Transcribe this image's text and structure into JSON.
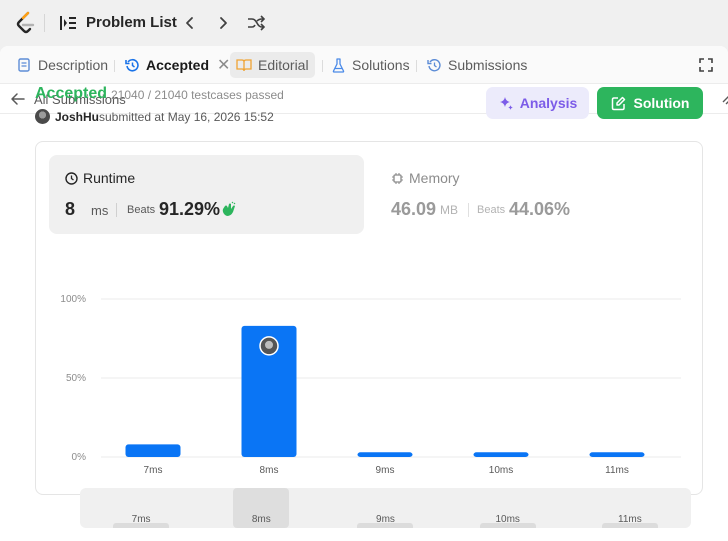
{
  "topbar": {
    "title": "Problem List",
    "icons": [
      "leetcode-logo-icon",
      "problem-list-icon",
      "chevron-left-icon",
      "chevron-right-icon",
      "shuffle-icon"
    ]
  },
  "tabs": [
    {
      "label": "Description",
      "icon": "description-icon"
    },
    {
      "label": "Accepted",
      "icon": "history-icon",
      "active": true,
      "closable": true
    },
    {
      "label": "Editorial",
      "icon": "book-icon"
    },
    {
      "label": "Solutions",
      "icon": "flask-icon"
    },
    {
      "label": "Submissions",
      "icon": "history-icon"
    }
  ],
  "back": {
    "label": "All Submissions"
  },
  "submission": {
    "status": "Accepted",
    "testcases": "21040 / 21040 testcases passed",
    "user": "JoshHu",
    "submitted": "submitted at May 16, 2026 15:52"
  },
  "buttons": {
    "analysis": "Analysis",
    "solution": "Solution"
  },
  "runtime": {
    "title": "Runtime",
    "value": "8",
    "unit": "ms",
    "beats_label": "Beats",
    "beats": "91.29%"
  },
  "memory": {
    "title": "Memory",
    "value": "46.09",
    "unit": "MB",
    "beats_label": "Beats",
    "beats": "44.06%"
  },
  "colors": {
    "accepted": "#2db55d",
    "bar": "#0a75f5",
    "analysis": "#7c5ce8"
  },
  "chart_data": {
    "type": "bar",
    "categories": [
      "7ms",
      "8ms",
      "9ms",
      "10ms",
      "11ms"
    ],
    "values": [
      8,
      83,
      3,
      3,
      3
    ],
    "highlight": "8ms",
    "yticks": [
      "0%",
      "50%",
      "100%"
    ],
    "ylim": [
      0,
      100
    ],
    "grid": true
  },
  "scroller": {
    "labels": [
      "7ms",
      "8ms",
      "9ms",
      "10ms",
      "11ms"
    ],
    "selected": "8ms"
  }
}
